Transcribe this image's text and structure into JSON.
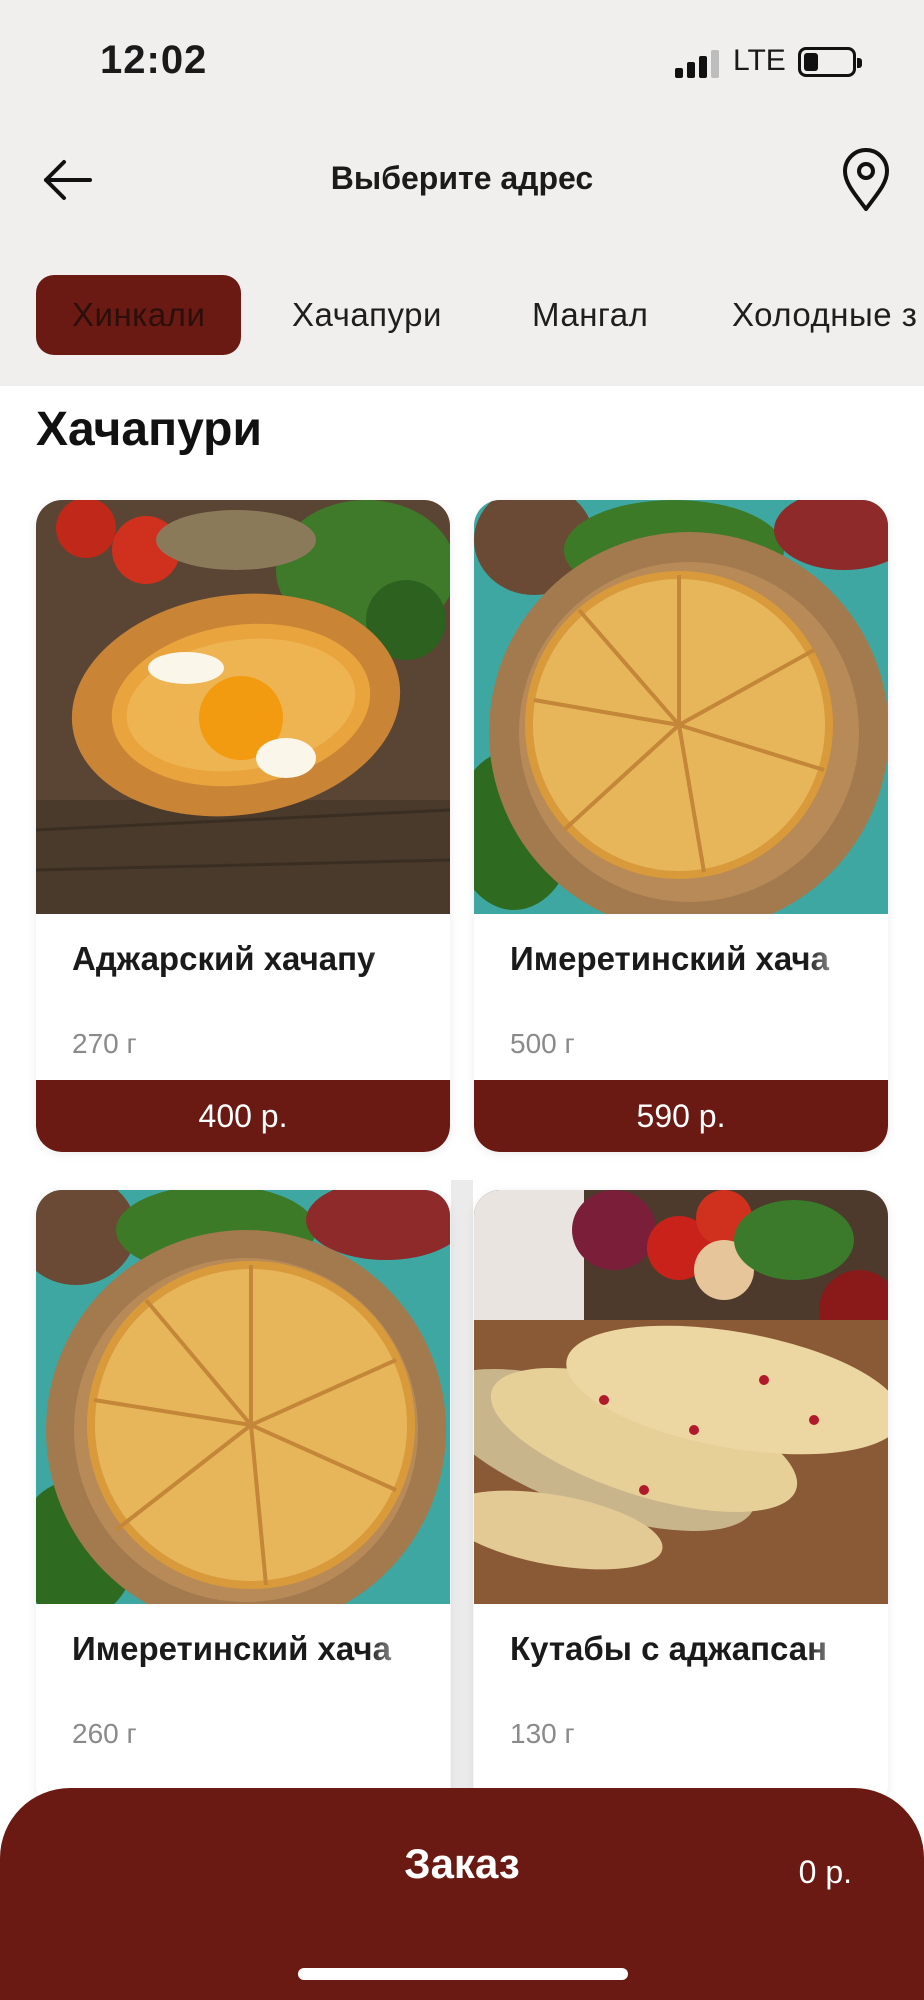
{
  "status_bar": {
    "time": "12:02",
    "network": "LTE",
    "battery_level": 0.3
  },
  "header": {
    "title": "Выберите адрес",
    "back_icon": "arrow-left-icon",
    "location_icon": "map-pin-icon"
  },
  "tabs": [
    {
      "label": "Хинкали",
      "active": true
    },
    {
      "label": "Хачапури",
      "active": false
    },
    {
      "label": "Мангал",
      "active": false
    },
    {
      "label": "Холодные з",
      "active": false
    }
  ],
  "section": {
    "title": "Хачапури"
  },
  "products": [
    {
      "name": "Аджарский хачапу",
      "weight": "270 г",
      "price": "400 р.",
      "image": "adjarian-khachapuri-photo"
    },
    {
      "name": "Имеретинский хача",
      "weight": "500 г",
      "price": "590 р.",
      "image": "imeretian-khachapuri-photo"
    },
    {
      "name": "Имеретинский хача",
      "weight": "260 г",
      "price": "",
      "image": "imeretian-khachapuri-photo"
    },
    {
      "name": "Кутабы с аджапсан",
      "weight": "130 г",
      "price": "",
      "image": "qutab-photo"
    }
  ],
  "order": {
    "label": "Заказ",
    "total": "0 р."
  },
  "colors": {
    "accent": "#6b1a13",
    "background_header": "#f0efed",
    "muted_text": "#8a8a8a"
  }
}
